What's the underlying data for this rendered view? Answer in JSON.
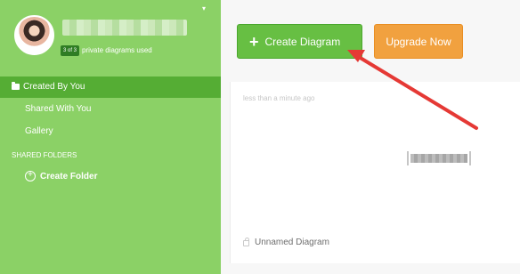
{
  "sidebar": {
    "profile": {
      "quota_badge": "3 of 3",
      "quota_text": "private diagrams used",
      "menu_indicator": "▾"
    },
    "nav": {
      "created_by_you": "Created By You",
      "shared_with_you": "Shared With You",
      "gallery": "Gallery"
    },
    "shared_folders": {
      "heading": "SHARED FOLDERS",
      "create_folder": "Create Folder"
    }
  },
  "toolbar": {
    "create_diagram": "Create Diagram",
    "create_plus": "+",
    "upgrade_now": "Upgrade Now"
  },
  "diagram": {
    "updated": "less than a minute ago",
    "name": "Unnamed Diagram"
  },
  "annotation": {
    "color": "#e53935"
  }
}
